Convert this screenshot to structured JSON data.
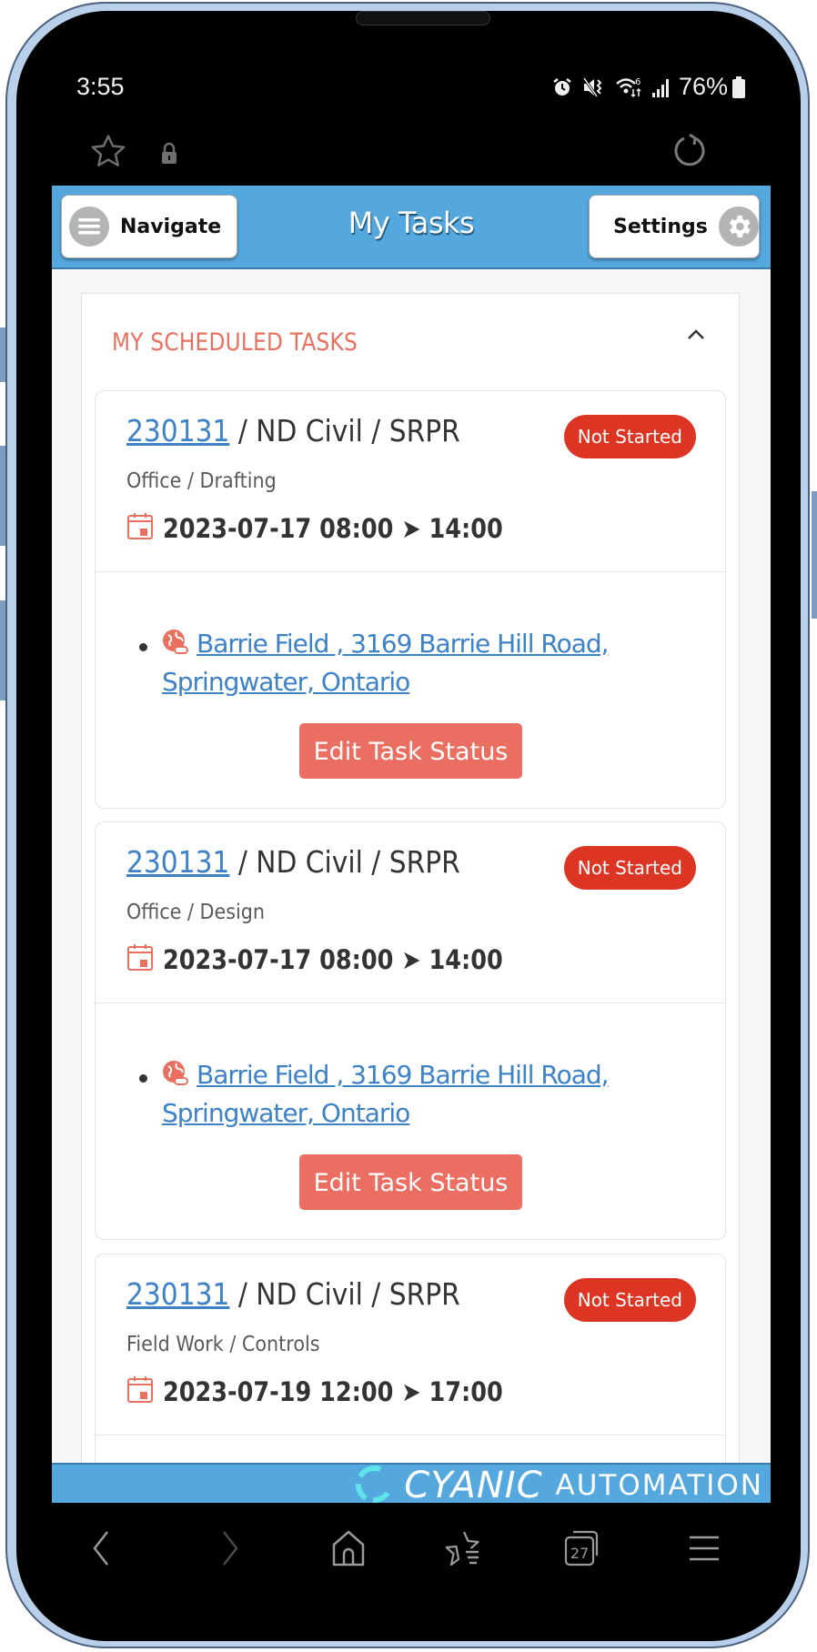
{
  "status_bar": {
    "time": "3:55",
    "battery": "76%",
    "icons": [
      "alarm-icon",
      "vibrate-mute-icon",
      "wifi-icon",
      "signal-icon",
      "battery-icon"
    ],
    "wifi_badge": "6"
  },
  "browser_top": {
    "icons": [
      "star-icon",
      "lock-icon",
      "reload-icon"
    ]
  },
  "header": {
    "title": "My Tasks",
    "nav_label": "Navigate",
    "settings_label": "Settings",
    "colors": {
      "bar": "#54a8dd",
      "text": "#ffffff"
    }
  },
  "panel": {
    "title": "MY SCHEDULED TASKS",
    "collapse_icon": "chevron-up-icon"
  },
  "tasks": [
    {
      "job": "230131",
      "rest": " / ND Civil / SRPR",
      "status": "Not Started",
      "category": "Office / Drafting",
      "schedule": "2023-07-17 08:00 ➤ 14:00",
      "location": "Barrie Field , 3169 Barrie Hill Road, Springwater, Ontario",
      "action": "Edit Task Status"
    },
    {
      "job": "230131",
      "rest": " / ND Civil / SRPR",
      "status": "Not Started",
      "category": "Office / Design",
      "schedule": "2023-07-17 08:00 ➤ 14:00",
      "location": "Barrie Field , 3169 Barrie Hill Road, Springwater, Ontario",
      "action": "Edit Task Status"
    },
    {
      "job": "230131",
      "rest": " / ND Civil / SRPR",
      "status": "Not Started",
      "category": "Field Work / Controls",
      "schedule": "2023-07-19 12:00 ➤ 17:00"
    }
  ],
  "footer": {
    "brand_main": "CYANIC",
    "brand_sub": "AUTOMATION"
  },
  "browser_nav": {
    "tab_count": "27",
    "icons": [
      "back-icon",
      "forward-icon",
      "home-icon",
      "bookmarks-icon",
      "tabs-icon",
      "menu-icon"
    ]
  },
  "colors": {
    "accent_red": "#dd3524",
    "button_salmon": "#ea6e61",
    "link_blue": "#3d82c7",
    "section_title": "#e8705f"
  }
}
